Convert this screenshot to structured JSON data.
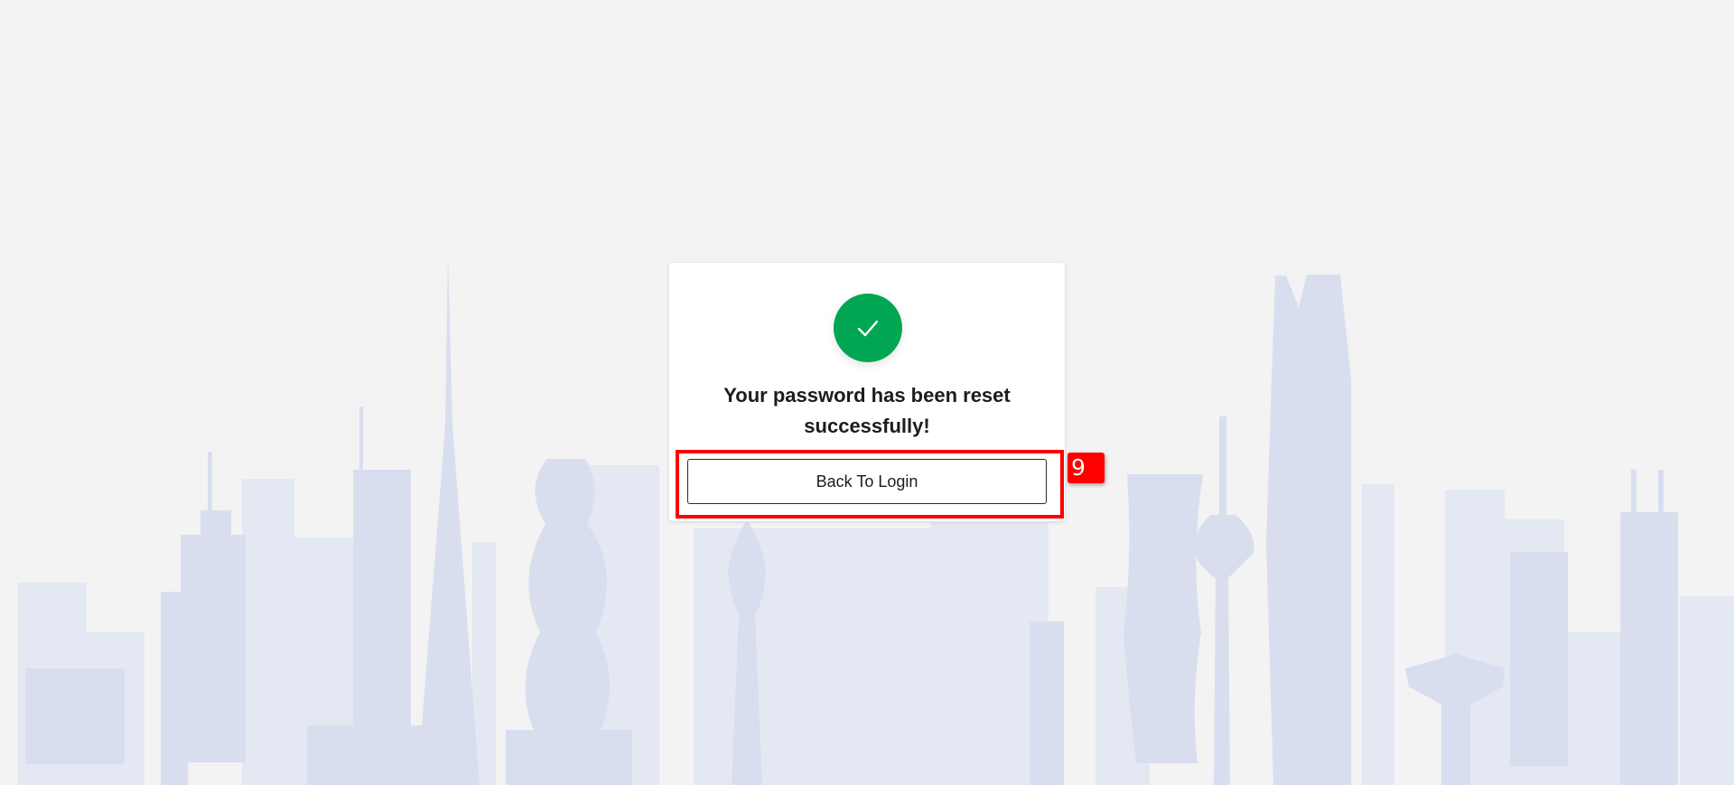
{
  "colors": {
    "background": "#f3f3f3",
    "skyline_light": "#e3e8f2",
    "skyline_dark": "#d9deef",
    "success_green": "#00a651",
    "marker_red": "#ff0000"
  },
  "background": {
    "icon": "city-skyline-illustration"
  },
  "card": {
    "icon": "check-icon",
    "message": "Your password has been reset successfully!",
    "back_button_label": "Back To Login"
  },
  "annotation": {
    "marker_label": "9"
  }
}
